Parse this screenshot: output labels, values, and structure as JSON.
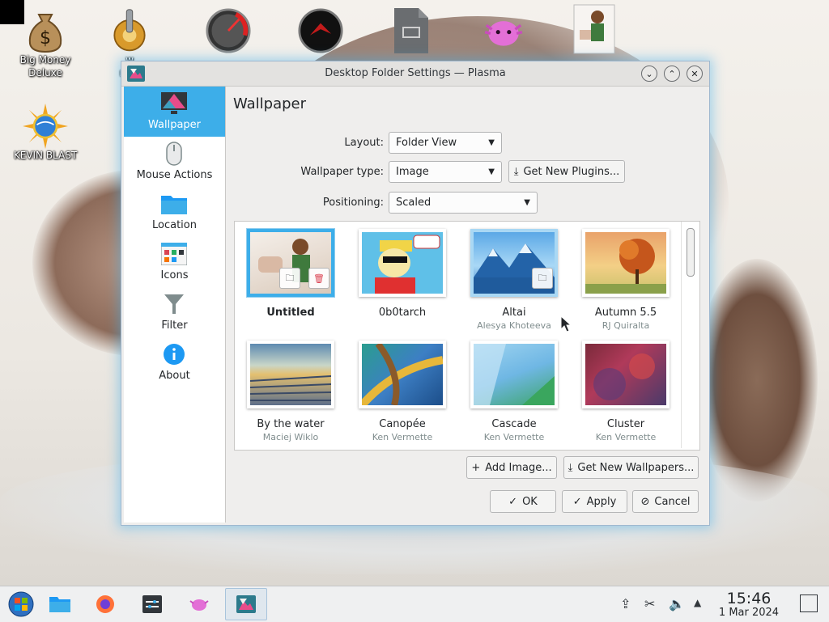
{
  "desktop": {
    "icons": [
      {
        "label": "Big Money\nDeluxe"
      },
      {
        "label": "w\nruss"
      },
      {
        "label": ""
      },
      {
        "label": ""
      },
      {
        "label": ""
      },
      {
        "label": ""
      },
      {
        "label": ""
      },
      {
        "label": "KEVIN BLAST"
      }
    ]
  },
  "dialog": {
    "title": "Desktop Folder Settings — Plasma",
    "sidebar": [
      {
        "label": "Wallpaper",
        "icon": "monitor-icon",
        "active": true
      },
      {
        "label": "Mouse Actions",
        "icon": "mouse-icon"
      },
      {
        "label": "Location",
        "icon": "folder-icon"
      },
      {
        "label": "Icons",
        "icon": "icons-icon"
      },
      {
        "label": "Filter",
        "icon": "filter-icon"
      },
      {
        "label": "About",
        "icon": "info-icon"
      }
    ],
    "page_title": "Wallpaper",
    "layout_label": "Layout:",
    "layout_value": "Folder View",
    "wallpaper_type_label": "Wallpaper type:",
    "wallpaper_type_value": "Image",
    "get_plugins_label": "Get New Plugins...",
    "positioning_label": "Positioning:",
    "positioning_value": "Scaled",
    "wallpapers": [
      {
        "name": "Untitled",
        "author": "",
        "selected": true
      },
      {
        "name": "0b0tarch",
        "author": ""
      },
      {
        "name": "Altai",
        "author": "Alesya Khoteeva"
      },
      {
        "name": "Autumn 5.5",
        "author": "RJ Quiralta"
      },
      {
        "name": "By the water",
        "author": "Maciej Wiklo"
      },
      {
        "name": "Canopée",
        "author": "Ken Vermette"
      },
      {
        "name": "Cascade",
        "author": "Ken Vermette"
      },
      {
        "name": "Cluster",
        "author": "Ken Vermette"
      }
    ],
    "add_image_label": "Add Image...",
    "get_wallpapers_label": "Get New Wallpapers...",
    "ok_label": "OK",
    "apply_label": "Apply",
    "cancel_label": "Cancel"
  },
  "taskbar": {
    "time": "15:46",
    "date": "1 Mar 2024"
  },
  "colors": {
    "accent": "#3daee9",
    "panel": "#eff0f1"
  }
}
